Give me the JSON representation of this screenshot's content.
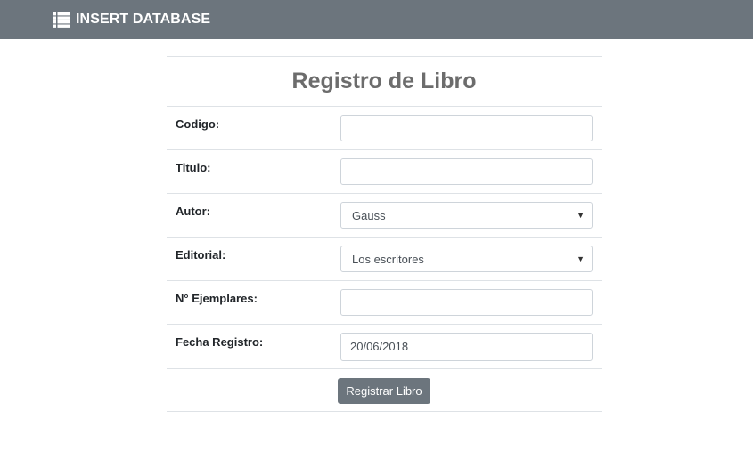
{
  "navbar": {
    "brand_label": "INSERT DATABASE",
    "brand_icon": "list-icon",
    "background": "#6c757d"
  },
  "form": {
    "title": "Registro de Libro",
    "fields": {
      "codigo": {
        "label": "Codigo:",
        "value": ""
      },
      "titulo": {
        "label": "Titulo:",
        "value": ""
      },
      "autor": {
        "label": "Autor:",
        "selected": "Gauss"
      },
      "editorial": {
        "label": "Editorial:",
        "selected": "Los escritores"
      },
      "ejemplares": {
        "label": "N° Ejemplares:",
        "value": ""
      },
      "fecha_registro": {
        "label": "Fecha Registro:",
        "value": "20/06/2018"
      }
    },
    "submit_label": "Registrar Libro"
  }
}
